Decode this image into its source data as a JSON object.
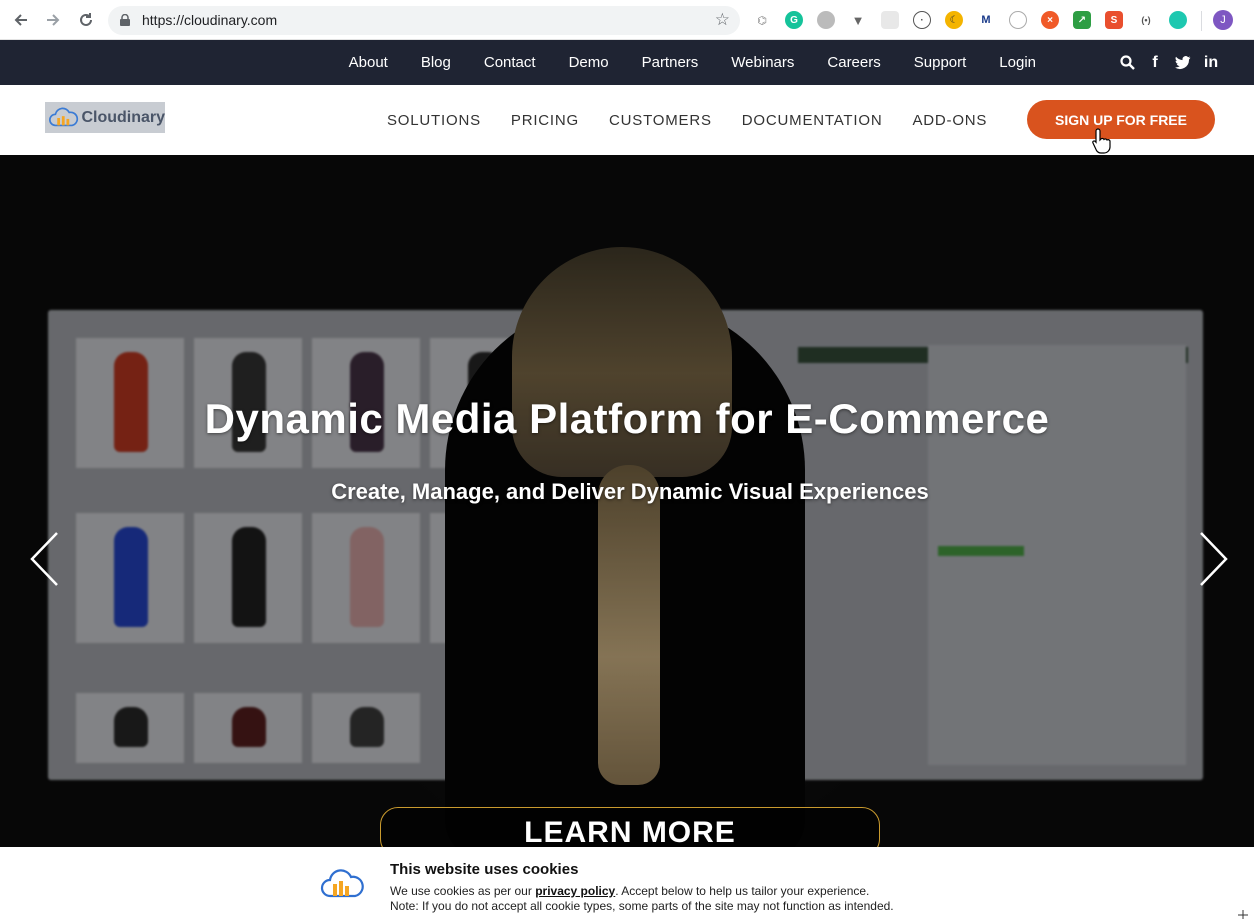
{
  "browser": {
    "url": "https://cloudinary.com",
    "profile_initial": "J"
  },
  "topbar": {
    "links": [
      "About",
      "Blog",
      "Contact",
      "Demo",
      "Partners",
      "Webinars",
      "Careers",
      "Support",
      "Login"
    ],
    "icons": [
      "search-icon",
      "facebook-icon",
      "twitter-icon",
      "linkedin-icon"
    ]
  },
  "nav": {
    "logo_text": "Cloudinary",
    "menu": [
      "SOLUTIONS",
      "PRICING",
      "CUSTOMERS",
      "DOCUMENTATION",
      "ADD-ONS"
    ],
    "signup_label": "SIGN UP FOR FREE",
    "signup_color": "#d9531e"
  },
  "hero": {
    "title": "Dynamic Media Platform for E-Commerce",
    "subtitle": "Create, Manage, and Deliver Dynamic Visual Experiences",
    "cta_label": "LEARN MORE"
  },
  "cookie": {
    "title": "This website uses cookies",
    "line1_before": "We use cookies as per our ",
    "line1_link": "privacy policy",
    "line1_after": ". Accept below to help us tailor your experience.",
    "line2": "Note: If you do not accept all cookie types, some parts of the site may not function as intended."
  },
  "colors": {
    "topbar_bg": "#1f2433",
    "accent": "#d9531e"
  }
}
